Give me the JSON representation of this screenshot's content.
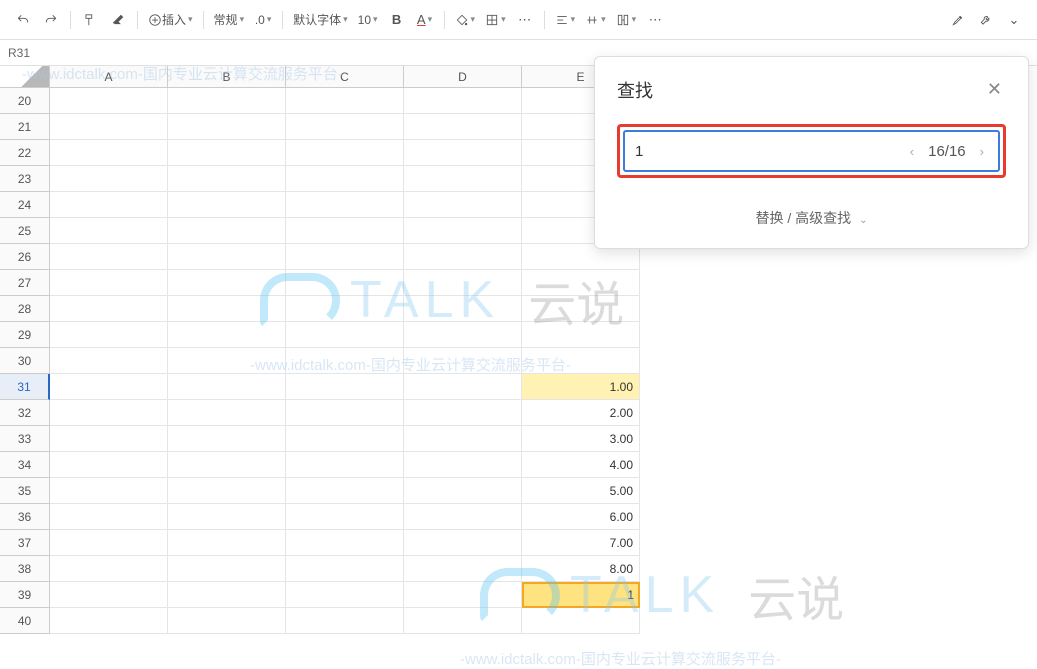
{
  "toolbar": {
    "insert_label": "插入",
    "format_label": "常规",
    "decimal_label": ".0",
    "font_label": "默认字体",
    "font_size": "10"
  },
  "namebox": {
    "ref": "R31"
  },
  "columns": [
    "A",
    "B",
    "C",
    "D",
    "E"
  ],
  "rows": [
    {
      "n": 20,
      "e": ""
    },
    {
      "n": 21,
      "e": ""
    },
    {
      "n": 22,
      "e": ""
    },
    {
      "n": 23,
      "e": ""
    },
    {
      "n": 24,
      "e": ""
    },
    {
      "n": 25,
      "e": ""
    },
    {
      "n": 26,
      "e": ""
    },
    {
      "n": 27,
      "e": ""
    },
    {
      "n": 28,
      "e": ""
    },
    {
      "n": 29,
      "e": ""
    },
    {
      "n": 30,
      "e": ""
    },
    {
      "n": 31,
      "e": "1.00",
      "hl": true,
      "sel": true
    },
    {
      "n": 32,
      "e": "2.00"
    },
    {
      "n": 33,
      "e": "3.00"
    },
    {
      "n": 34,
      "e": "4.00"
    },
    {
      "n": 35,
      "e": "5.00"
    },
    {
      "n": 36,
      "e": "6.00"
    },
    {
      "n": 37,
      "e": "7.00"
    },
    {
      "n": 38,
      "e": "8.00"
    },
    {
      "n": 39,
      "e": "1",
      "hl": true,
      "active": true
    },
    {
      "n": 40,
      "e": ""
    }
  ],
  "find": {
    "title": "查找",
    "value": "1",
    "counter": "16/16",
    "replace_label": "替换 / 高级查找"
  },
  "watermark": {
    "line": "-www.idctalk.com-国内专业云计算交流服务平台-",
    "logo_txt": "TALK",
    "logo_cn": "云说"
  }
}
